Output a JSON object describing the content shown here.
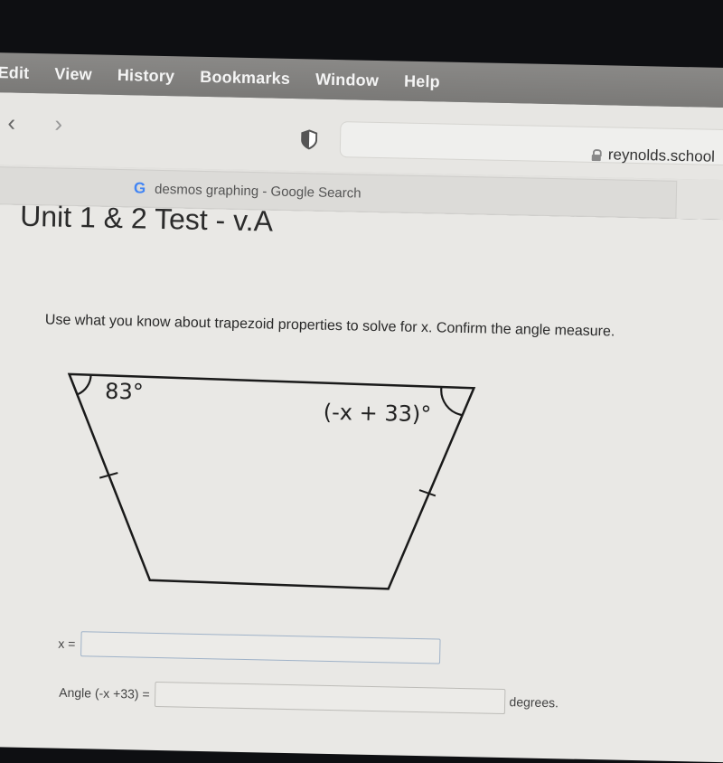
{
  "menubar": {
    "items": [
      "Edit",
      "View",
      "History",
      "Bookmarks",
      "Window",
      "Help"
    ]
  },
  "toolbar": {
    "back_icon": "chevron-left",
    "forward_icon": "chevron-right",
    "privacy_icon": "shield",
    "url": "reynolds.school"
  },
  "tab": {
    "favicon": "G",
    "title": "desmos graphing - Google Search"
  },
  "page": {
    "title": "Unit 1 & 2 Test - v.A",
    "question": "Use what you know about trapezoid properties to solve for x. Confirm the angle measure.",
    "figure": {
      "shape": "isosceles trapezoid",
      "angle_top_left": "83°",
      "angle_top_right": "(-x + 33)°",
      "congruent_leg_marks": true
    },
    "answers": [
      {
        "label": "x =",
        "value": "",
        "suffix": ""
      },
      {
        "label": "Angle (-x +33) =",
        "value": "",
        "suffix": "degrees."
      }
    ]
  }
}
